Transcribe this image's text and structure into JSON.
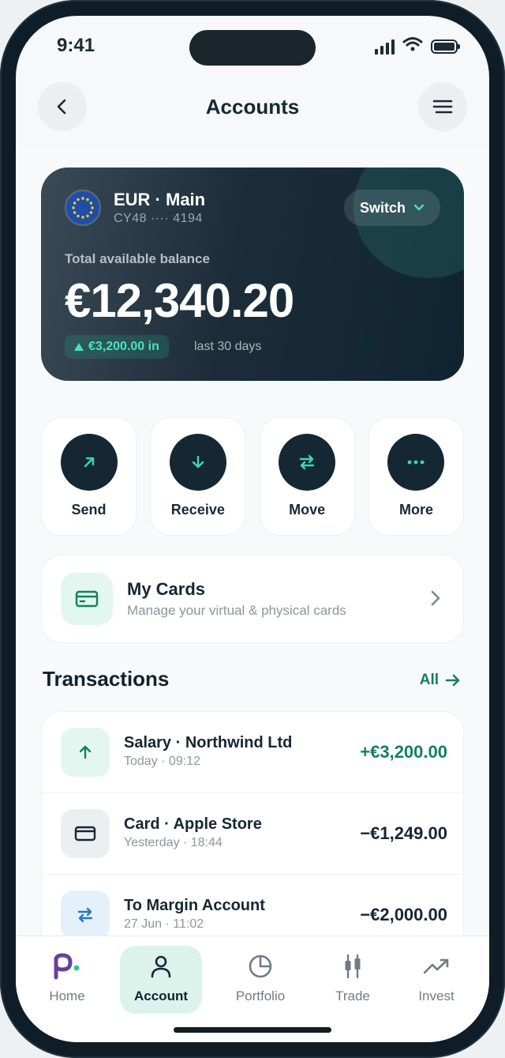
{
  "status": {
    "time": "9:41"
  },
  "header": {
    "title": "Accounts"
  },
  "account": {
    "name": "EUR · Main",
    "number": "CY48 ···· 4194",
    "switch_label": "Switch",
    "balance_label": "Total available balance",
    "balance": "€12,340.20",
    "change": "€3,200.00 in",
    "period": "last 30 days"
  },
  "actions": [
    {
      "label": "Send",
      "icon": "arrow-up-right-icon"
    },
    {
      "label": "Receive",
      "icon": "arrow-down-icon"
    },
    {
      "label": "Move",
      "icon": "swap-icon"
    },
    {
      "label": "More",
      "icon": "more-dots-icon"
    }
  ],
  "cards": {
    "title": "My Cards",
    "subtitle": "Manage your virtual & physical cards"
  },
  "transactions": {
    "heading": "Transactions",
    "all_label": "All",
    "items": [
      {
        "title": "Salary · Northwind Ltd",
        "subtitle": "Today · 09:12",
        "amount": "+€3,200.00",
        "icon": "arrow-up-icon"
      },
      {
        "title": "Card · Apple Store",
        "subtitle": "Yesterday · 18:44",
        "amount": "−€1,249.00",
        "icon": "card-icon"
      },
      {
        "title": "To Margin Account",
        "subtitle": "27 Jun · 11:02",
        "amount": "−€2,000.00",
        "icon": "swap-icon"
      }
    ]
  },
  "tabs": [
    {
      "label": "Home",
      "icon": "logo-icon"
    },
    {
      "label": "Account",
      "icon": "person-icon",
      "active": true
    },
    {
      "label": "Portfolio",
      "icon": "pie-chart-icon"
    },
    {
      "label": "Trade",
      "icon": "candlestick-icon"
    },
    {
      "label": "Invest",
      "icon": "trend-icon"
    }
  ],
  "colors": {
    "accent": "#14805e",
    "dark": "#142733",
    "mint": "#4fe0c0"
  }
}
